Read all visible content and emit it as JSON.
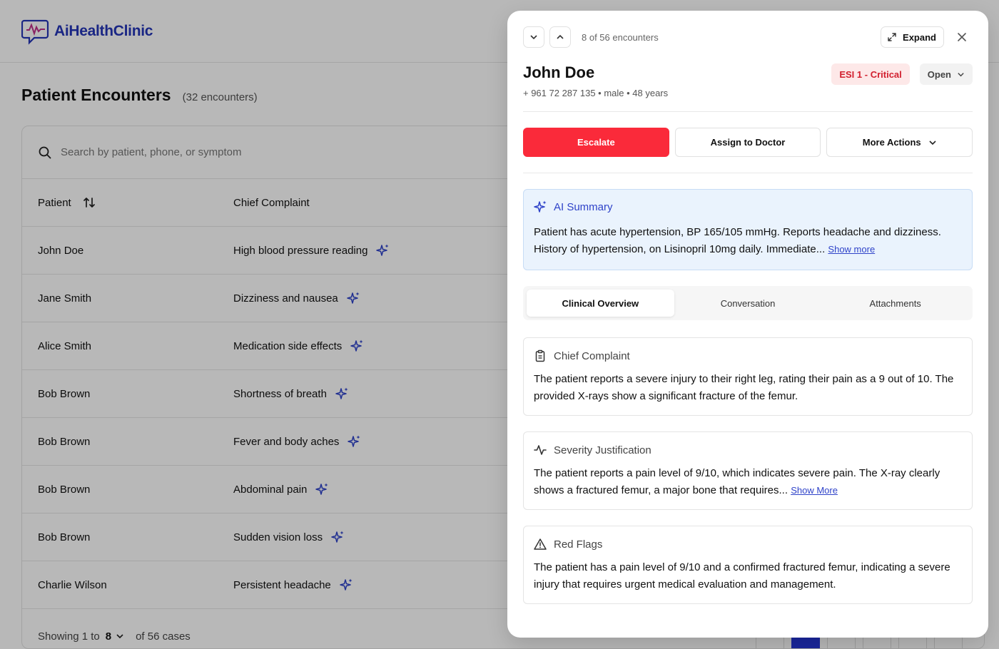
{
  "brand": {
    "name": "AiHealthClinic",
    "color": "#2435b8"
  },
  "page": {
    "title": "Patient Encounters",
    "count": "(32 encounters)"
  },
  "search": {
    "placeholder": "Search by patient, phone, or symptom",
    "icon": "search-icon"
  },
  "table": {
    "headers": {
      "patient": "Patient",
      "complaint": "Chief Complaint"
    },
    "rows": [
      {
        "patient": "John Doe",
        "complaint": "High blood pressure reading"
      },
      {
        "patient": "Jane Smith",
        "complaint": "Dizziness and nausea"
      },
      {
        "patient": "Alice Smith",
        "complaint": "Medication side effects"
      },
      {
        "patient": "Bob Brown",
        "complaint": "Shortness of breath"
      },
      {
        "patient": "Bob Brown",
        "complaint": "Fever and body aches"
      },
      {
        "patient": "Bob Brown",
        "complaint": "Abdominal pain"
      },
      {
        "patient": "Bob Brown",
        "complaint": "Sudden vision loss"
      },
      {
        "patient": "Charlie Wilson",
        "complaint": "Persistent headache"
      }
    ]
  },
  "footer": {
    "prefix": "Showing 1 to",
    "per_page": "8",
    "suffix": "of 56 cases"
  },
  "panel": {
    "encounter_position": "8 of 56 encounters",
    "expand_label": "Expand",
    "patient_name": "John Doe",
    "patient_meta": "+ 961 72 287 135 • male • 48 years",
    "esi": "ESI 1 - Critical",
    "status": "Open",
    "actions": {
      "escalate": "Escalate",
      "assign": "Assign to Doctor",
      "more": "More Actions"
    },
    "ai_summary": {
      "title": "AI Summary",
      "text": "Patient has acute hypertension, BP 165/105 mmHg. Reports headache and dizziness. History of hypertension, on Lisinopril 10mg daily. Immediate...",
      "more": "Show more"
    },
    "tabs": [
      "Clinical Overview",
      "Conversation",
      "Attachments"
    ],
    "sections": {
      "chief_complaint": {
        "title": "Chief Complaint",
        "text": "The patient reports a severe injury to their right leg, rating their pain as a 9 out of 10. The provided X-rays show a significant fracture of the femur."
      },
      "severity": {
        "title": "Severity Justification",
        "text": "The patient reports a pain level of 9/10, which indicates severe pain. The X-ray clearly shows a fractured femur, a major bone that requires...",
        "more": "Show More"
      },
      "red_flags": {
        "title": "Red Flags",
        "text": "The patient has a pain level of 9/10 and a confirmed fractured femur, indicating a severe injury that requires urgent medical evaluation and management."
      }
    }
  },
  "colors": {
    "accent": "#2f43c9",
    "danger": "#fa2a3a",
    "esi_bg": "#fde8e8",
    "esi_text": "#d2202f"
  }
}
